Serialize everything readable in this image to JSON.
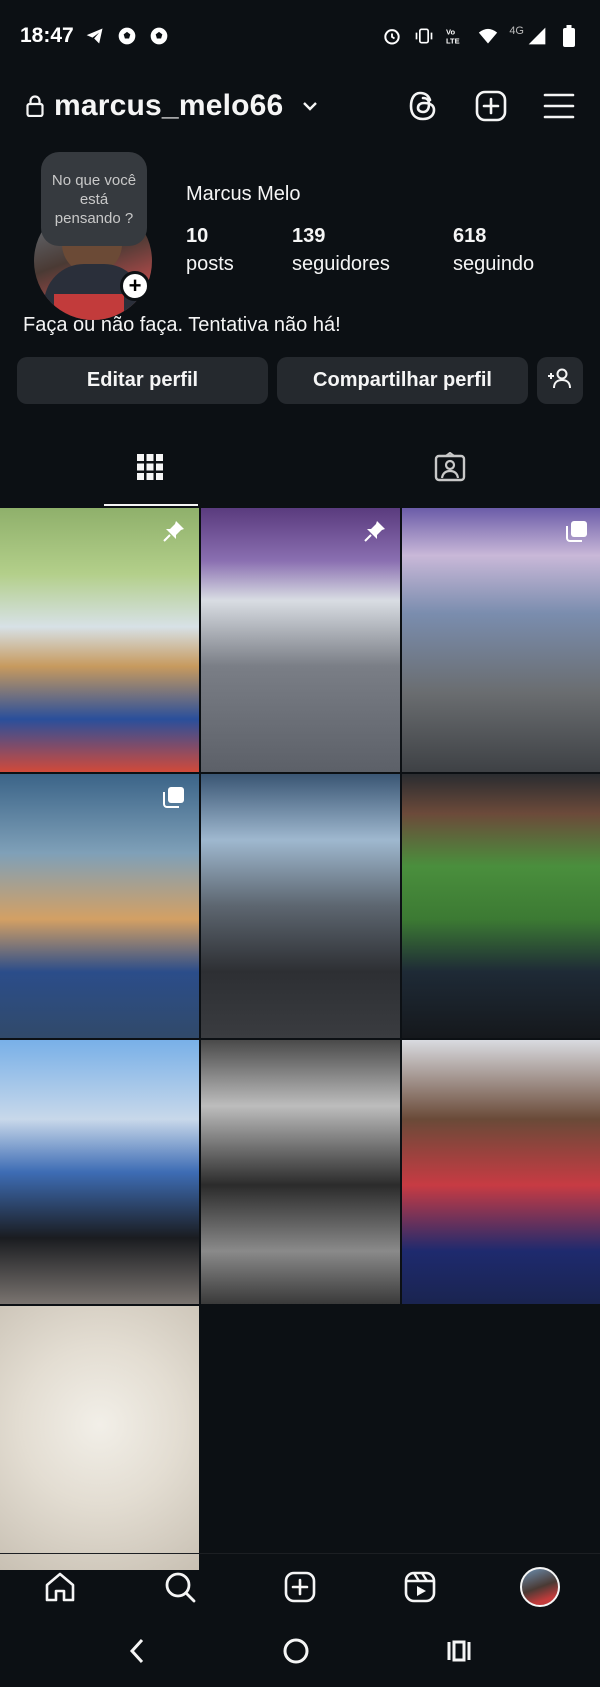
{
  "statusbar": {
    "time": "18:47",
    "network": "4G",
    "icons": [
      "telegram-icon",
      "soccer-ball-icon",
      "soccer-ball-icon",
      "alarm-icon",
      "vibrate-icon",
      "volte-icon",
      "wifi-icon",
      "signal-icon",
      "battery-icon"
    ]
  },
  "header": {
    "username": "marcus_melo66",
    "icons": [
      "lock-icon",
      "chevron-down-icon",
      "threads-icon",
      "new-post-icon",
      "menu-icon"
    ]
  },
  "profile": {
    "note": "No que você está pensando ?",
    "full_name": "Marcus Melo",
    "bio": "Faça ou não faça. Tentativa não há!",
    "stats": [
      {
        "value": "10",
        "label": "posts"
      },
      {
        "value": "139",
        "label": "seguidores"
      },
      {
        "value": "618",
        "label": "seguindo"
      }
    ]
  },
  "buttons": {
    "edit": "Editar perfil",
    "share": "Compartilhar perfil"
  },
  "tabs": [
    "grid-icon",
    "tagged-icon"
  ],
  "posts": [
    {
      "badge": "pin-icon"
    },
    {
      "badge": "pin-icon"
    },
    {
      "badge": "carousel-icon"
    },
    {
      "badge": "carousel-icon"
    },
    {
      "badge": ""
    },
    {
      "badge": ""
    },
    {
      "badge": ""
    },
    {
      "badge": ""
    },
    {
      "badge": ""
    },
    {
      "badge": ""
    }
  ],
  "bottom_nav": [
    "home-icon",
    "search-icon",
    "create-icon",
    "reels-icon",
    "profile-avatar"
  ],
  "system_nav": [
    "back-icon",
    "home-circle-icon",
    "recents-icon"
  ]
}
